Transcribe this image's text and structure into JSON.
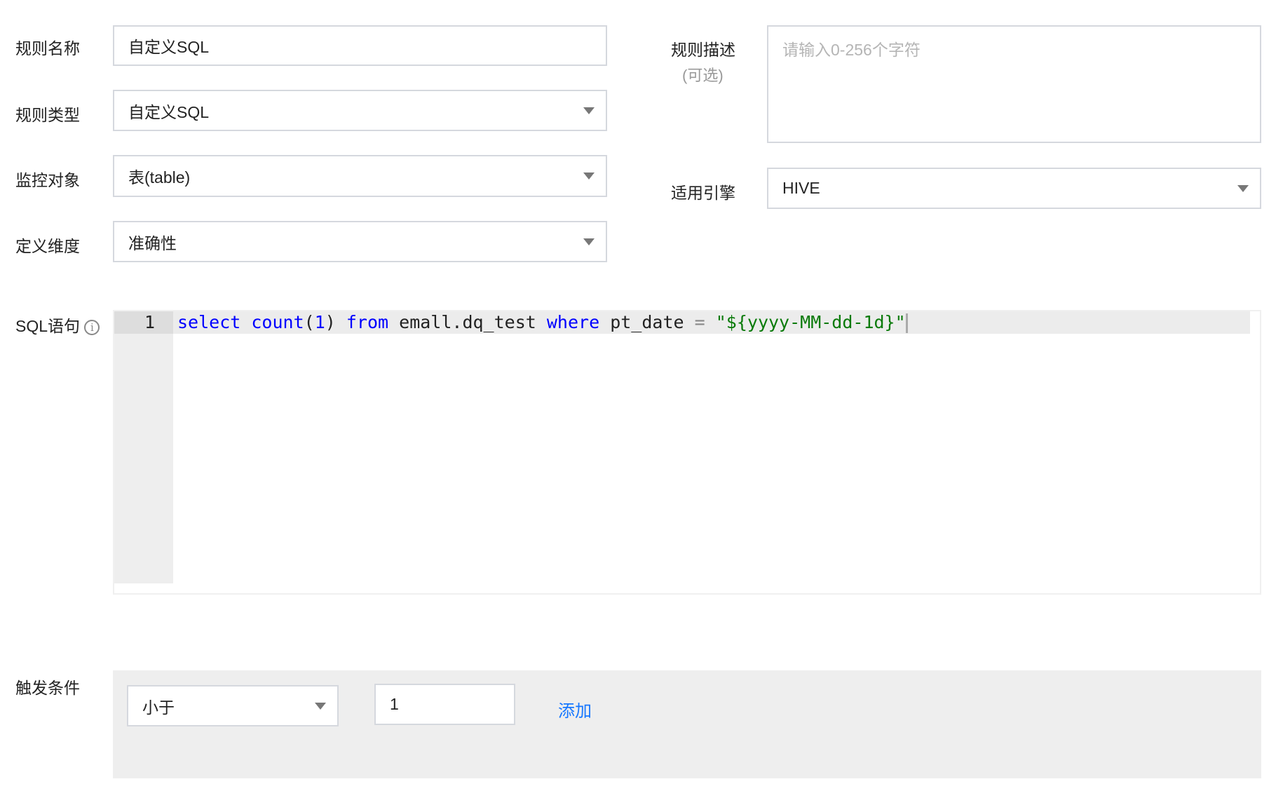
{
  "form": {
    "rule_name": {
      "label": "规则名称",
      "value": "自定义SQL"
    },
    "rule_type": {
      "label": "规则类型",
      "value": "自定义SQL"
    },
    "monitor_object": {
      "label": "监控对象",
      "value": "表(table)"
    },
    "dimension": {
      "label": "定义维度",
      "value": "准确性"
    },
    "description": {
      "label": "规则描述",
      "sub_label": "(可选)",
      "placeholder": "请输入0-256个字符"
    },
    "engine": {
      "label": "适用引擎",
      "value": "HIVE"
    },
    "sql": {
      "label": "SQL语句",
      "line_number": "1",
      "tokens": {
        "t1": "select",
        "t2": " ",
        "t3": "count",
        "t4": "(",
        "t5": "1",
        "t6": ") ",
        "t7": "from",
        "t8": " emall.dq_test ",
        "t9": "where",
        "t10": " pt_date ",
        "t11": "=",
        "t12": " ",
        "t13": "\"${yyyy-MM-dd-1d}\""
      }
    },
    "trigger": {
      "label": "触发条件",
      "operator": "小于",
      "value": "1",
      "add_label": "添加"
    }
  },
  "colors": {
    "keyword": "#0000ff",
    "string": "#0a7a0a",
    "link": "#1677ff"
  }
}
